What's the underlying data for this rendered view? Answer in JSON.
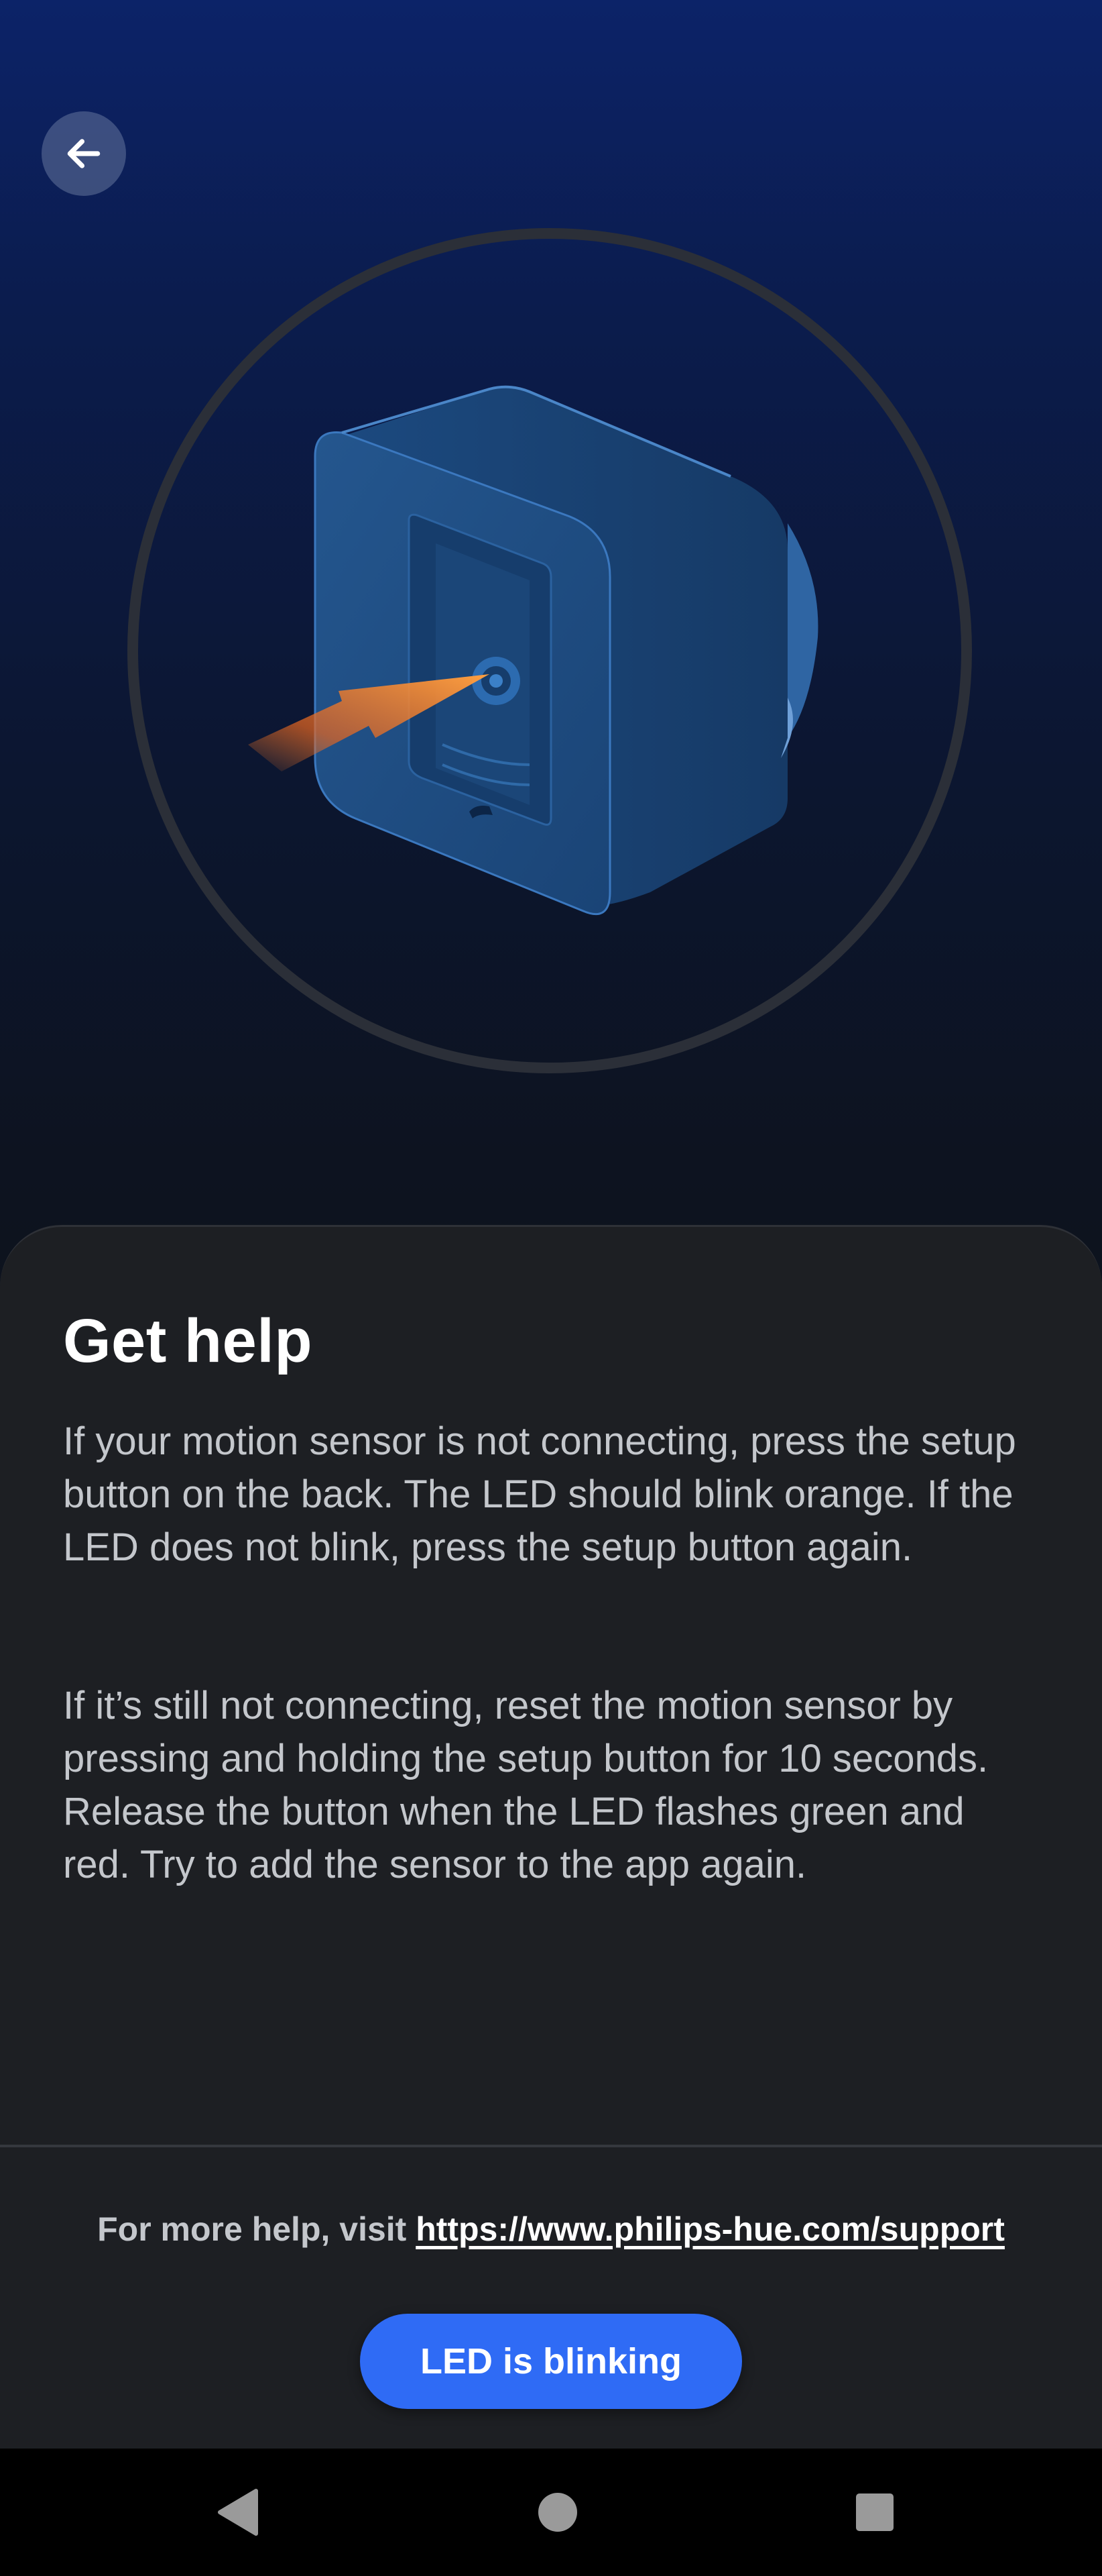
{
  "header": {
    "back_icon": "arrow-left-icon"
  },
  "illustration": {
    "subject": "motion-sensor-back-icon",
    "highlight_color": "#f07a2a"
  },
  "content": {
    "title": "Get help",
    "paragraph_1": "If your motion sensor is not connecting, press the setup button on the back. The LED should blink orange. If the LED does not blink, press the setup button again.",
    "paragraph_2": "If it’s still not connecting, reset the motion sensor by pressing and holding the setup button for 10 seconds. Release the button when the LED flashes green and red. Try to add the sensor to the app again."
  },
  "footer": {
    "help_prefix": "For more help, visit ",
    "help_link": "https://www.philips-hue.com/support",
    "primary_button": "LED is blinking",
    "accent_color": "#2f6bf5"
  },
  "navbar": {
    "back_icon": "triangle-back-icon",
    "home_icon": "circle-home-icon",
    "recents_icon": "square-recents-icon"
  }
}
